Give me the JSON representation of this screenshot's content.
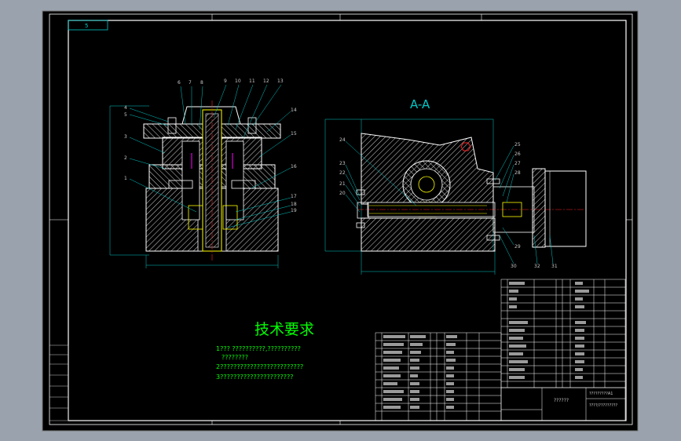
{
  "view_title": "A-A",
  "title_corner": "5",
  "tech_requirements": {
    "heading": "技术要求",
    "line1": "1??? ??????????,??????????",
    "line2": "????????",
    "line3": "2?????????????????????????",
    "line4": "3??????????????????????"
  },
  "title_block": {
    "text1": "?????????A1",
    "text2": "??????",
    "text3": "????/?????????"
  },
  "left_balloons": [
    "6",
    "7",
    "8",
    "9",
    "10",
    "11",
    "12",
    "13",
    "14",
    "15",
    "16",
    "17",
    "18",
    "19",
    "4",
    "5",
    "3",
    "2",
    "1"
  ],
  "right_balloons": [
    "24",
    "23",
    "22",
    "21",
    "20",
    "25",
    "26",
    "27",
    "28",
    "29",
    "30",
    "32",
    "31"
  ],
  "colors": {
    "screen_bg": "#9aa3ad",
    "paper": "#000000",
    "frame": "#ffffff",
    "dimension": "#00c8c8",
    "part_outline": "#ffffff",
    "hatch": "#d8d8d8",
    "center_line": "#ff2020",
    "highlight": "#ffff00",
    "magenta": "#ff00ff",
    "green_text": "#00ff00",
    "table_text": "#c8c8c8"
  }
}
